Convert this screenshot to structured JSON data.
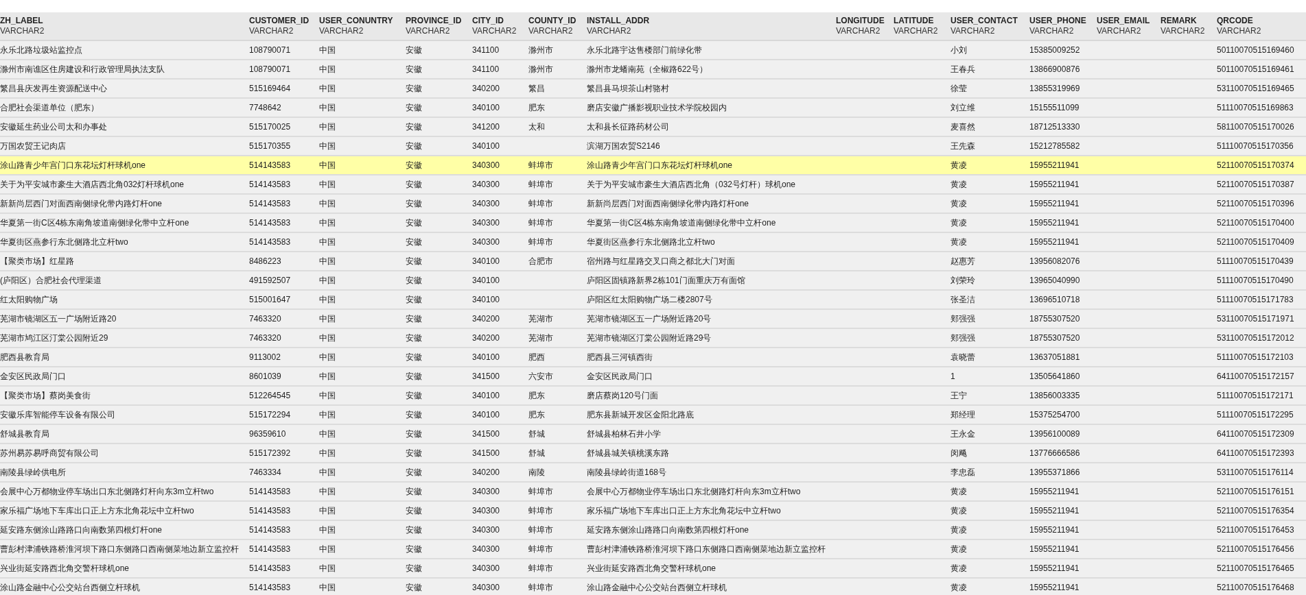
{
  "table": {
    "columns": [
      {
        "name": "ZH_LABEL",
        "type": "VARCHAR2"
      },
      {
        "name": "CUSTOMER_ID",
        "type": "VARCHAR2"
      },
      {
        "name": "USER_CONUNTRY",
        "type": "VARCHAR2"
      },
      {
        "name": "PROVINCE_ID",
        "type": "VARCHAR2"
      },
      {
        "name": "CITY_ID",
        "type": "VARCHAR2"
      },
      {
        "name": "COUNTY_ID",
        "type": "VARCHAR2"
      },
      {
        "name": "INSTALL_ADDR",
        "type": "VARCHAR2"
      },
      {
        "name": "LONGITUDE",
        "type": "VARCHAR2"
      },
      {
        "name": "LATITUDE",
        "type": "VARCHAR2"
      },
      {
        "name": "USER_CONTACT",
        "type": "VARCHAR2"
      },
      {
        "name": "USER_PHONE",
        "type": "VARCHAR2"
      },
      {
        "name": "USER_EMAIL",
        "type": "VARCHAR2"
      },
      {
        "name": "REMARK",
        "type": "VARCHAR2"
      },
      {
        "name": "QRCODE",
        "type": "VARCHAR2"
      }
    ],
    "rows": [
      {
        "selected": false,
        "zh_label": "永乐北路垃圾站监控点",
        "customer_id": "108790071",
        "country": "中国",
        "province": "安徽",
        "city_id": "341100",
        "county": "滁州市",
        "install_addr": "永乐北路宇达售楼部门前绿化带",
        "contact": "小刘",
        "phone": "15385009252",
        "qrcode": "50110070515169460"
      },
      {
        "selected": false,
        "zh_label": "滁州市南谯区住房建设和行政管理局执法支队",
        "customer_id": "108790071",
        "country": "中国",
        "province": "安徽",
        "city_id": "341100",
        "county": "滁州市",
        "install_addr": "滁州市龙蟠南苑（全椒路622号）",
        "contact": "王春兵",
        "phone": "13866900876",
        "qrcode": "50110070515169461"
      },
      {
        "selected": false,
        "zh_label": "繁昌县庆发再生资源配送中心",
        "customer_id": "515169464",
        "country": "中国",
        "province": "安徽",
        "city_id": "340200",
        "county": "繁昌",
        "install_addr": "繁昌县马坝茶山村骆村",
        "contact": "徐莹",
        "phone": "13855319969",
        "qrcode": "53110070515169465"
      },
      {
        "selected": false,
        "zh_label": "合肥社会渠道单位（肥东）",
        "customer_id": "7748642",
        "country": "中国",
        "province": "安徽",
        "city_id": "340100",
        "county": "肥东",
        "install_addr": "磨店安徽广播影视职业技术学院校园内",
        "contact": "刘立维",
        "phone": "15155511099",
        "qrcode": "51110070515169863"
      },
      {
        "selected": false,
        "zh_label": "安徽延生药业公司太和办事处",
        "customer_id": "515170025",
        "country": "中国",
        "province": "安徽",
        "city_id": "341200",
        "county": "太和",
        "install_addr": "太和县长征路药材公司",
        "contact": "麦喜然",
        "phone": "18712513330",
        "qrcode": "58110070515170026"
      },
      {
        "selected": false,
        "zh_label": "万国农贸王记肉店",
        "customer_id": "515170355",
        "country": "中国",
        "province": "安徽",
        "city_id": "340100",
        "install_addr": "滨湖万国农贸S2146",
        "contact": "王先森",
        "phone": "15212785582",
        "qrcode": "51110070515170356"
      },
      {
        "selected": true,
        "zh_label": "涂山路青少年宫门口东花坛灯杆球机one",
        "customer_id": "514143583",
        "country": "中国",
        "province": "安徽",
        "city_id": "340300",
        "county": "蚌埠市",
        "install_addr": "涂山路青少年宫门口东花坛灯杆球机one",
        "contact": "黄凌",
        "phone": "15955211941",
        "qrcode": "52110070515170374"
      },
      {
        "selected": false,
        "zh_label": "关于为平安城市豪生大酒店西北角032灯杆球机one",
        "customer_id": "514143583",
        "country": "中国",
        "province": "安徽",
        "city_id": "340300",
        "county": "蚌埠市",
        "install_addr": "关于为平安城市豪生大酒店西北角（032号灯杆）球机one",
        "contact": "黄凌",
        "phone": "15955211941",
        "qrcode": "52110070515170387"
      },
      {
        "selected": false,
        "zh_label": "新新尚层西门对面西南侧绿化带内路灯杆one",
        "customer_id": "514143583",
        "country": "中国",
        "province": "安徽",
        "city_id": "340300",
        "county": "蚌埠市",
        "install_addr": "新新尚层西门对面西南侧绿化带内路灯杆one",
        "contact": "黄凌",
        "phone": "15955211941",
        "qrcode": "52110070515170396"
      },
      {
        "selected": false,
        "zh_label": "华夏第一街C区4栋东南角坡道南侧绿化带中立杆one",
        "customer_id": "514143583",
        "country": "中国",
        "province": "安徽",
        "city_id": "340300",
        "county": "蚌埠市",
        "install_addr": "华夏第一街C区4栋东南角坡道南侧绿化带中立杆one",
        "contact": "黄凌",
        "phone": "15955211941",
        "qrcode": "52110070515170400"
      },
      {
        "selected": false,
        "zh_label": "华夏街区燕参行东北侧路北立杆two",
        "customer_id": "514143583",
        "country": "中国",
        "province": "安徽",
        "city_id": "340300",
        "county": "蚌埠市",
        "install_addr": "华夏街区燕参行东北侧路北立杆two",
        "contact": "黄凌",
        "phone": "15955211941",
        "qrcode": "52110070515170409"
      },
      {
        "selected": false,
        "zh_label": "【聚类市场】红星路",
        "customer_id": "8486223",
        "country": "中国",
        "province": "安徽",
        "city_id": "340100",
        "county": "合肥市",
        "install_addr": "宿州路与红星路交叉口商之都北大门对面",
        "contact": "赵惠芳",
        "phone": "13956082076",
        "qrcode": "51110070515170439"
      },
      {
        "selected": false,
        "zh_label": "(庐阳区）合肥社会代理渠道",
        "customer_id": "491592507",
        "country": "中国",
        "province": "安徽",
        "city_id": "340100",
        "install_addr": "庐阳区固镇路新界2栋101门面重庆万有面馆",
        "contact": "刘荣玲",
        "phone": "13965040990",
        "qrcode": "51110070515170490"
      },
      {
        "selected": false,
        "zh_label": "红太阳购物广场",
        "customer_id": "515001647",
        "country": "中国",
        "province": "安徽",
        "city_id": "340100",
        "install_addr": "庐阳区红太阳购物广场二楼2807号",
        "contact": "张圣洁",
        "phone": "13696510718",
        "qrcode": "51110070515171783"
      },
      {
        "selected": false,
        "zh_label": "芜湖市镜湖区五一广场附近路20",
        "customer_id": "7463320",
        "country": "中国",
        "province": "安徽",
        "city_id": "340200",
        "county": "芜湖市",
        "install_addr": "芜湖市镜湖区五一广场附近路20号",
        "contact": "郏强强",
        "phone": "18755307520",
        "qrcode": "53110070515171971"
      },
      {
        "selected": false,
        "zh_label": "芜湖市鸠江区汀棠公园附近29",
        "customer_id": "7463320",
        "country": "中国",
        "province": "安徽",
        "city_id": "340200",
        "county": "芜湖市",
        "install_addr": "芜湖市镜湖区汀棠公园附近路29号",
        "contact": "郏强强",
        "phone": "18755307520",
        "qrcode": "53110070515172012"
      },
      {
        "selected": false,
        "zh_label": "肥西县教育局",
        "customer_id": "9113002",
        "country": "中国",
        "province": "安徽",
        "city_id": "340100",
        "county": "肥西",
        "install_addr": "肥西县三河镇西街",
        "contact": "袁晓蕾",
        "phone": "13637051881",
        "qrcode": "51110070515172103"
      },
      {
        "selected": false,
        "zh_label": "金安区民政局门口",
        "customer_id": "8601039",
        "country": "中国",
        "province": "安徽",
        "city_id": "341500",
        "county": "六安市",
        "install_addr": "金安区民政局门口",
        "contact": "1",
        "phone": "13505641860",
        "qrcode": "64110070515172157"
      },
      {
        "selected": false,
        "zh_label": "【聚类市场】蔡岗美食街",
        "customer_id": "512264545",
        "country": "中国",
        "province": "安徽",
        "city_id": "340100",
        "county": "肥东",
        "install_addr": "磨店蔡岗120号门面",
        "contact": "王宁",
        "phone": "13856003335",
        "qrcode": "51110070515172171"
      },
      {
        "selected": false,
        "zh_label": "安徽乐库智能停车设备有限公司",
        "customer_id": "515172294",
        "country": "中国",
        "province": "安徽",
        "city_id": "340100",
        "county": "肥东",
        "install_addr": "肥东县新城开发区金阳北路底",
        "contact": "郑经理",
        "phone": "15375254700",
        "qrcode": "51110070515172295"
      },
      {
        "selected": false,
        "zh_label": "舒城县教育局",
        "customer_id": "96359610",
        "country": "中国",
        "province": "安徽",
        "city_id": "341500",
        "county": "舒城",
        "install_addr": "舒城县柏林石井小学",
        "contact": "王永金",
        "phone": "13956100089",
        "qrcode": "64110070515172309"
      },
      {
        "selected": false,
        "zh_label": "苏州易苏易呼商贸有限公司",
        "customer_id": "515172392",
        "country": "中国",
        "province": "安徽",
        "city_id": "341500",
        "county": "舒城",
        "install_addr": "舒城县城关镇桃溪东路",
        "contact": "闵飚",
        "phone": "13776666586",
        "qrcode": "64110070515172393"
      },
      {
        "selected": false,
        "zh_label": "南陵县绿岭供电所",
        "customer_id": "7463334",
        "country": "中国",
        "province": "安徽",
        "city_id": "340200",
        "county": "南陵",
        "install_addr": "南陵县绿岭街道168号",
        "contact": "李忠磊",
        "phone": "13955371866",
        "qrcode": "53110070515176114"
      },
      {
        "selected": false,
        "zh_label": "会展中心万都物业停车场出口东北侧路灯杆向东3m立杆two",
        "customer_id": "514143583",
        "country": "中国",
        "province": "安徽",
        "city_id": "340300",
        "county": "蚌埠市",
        "install_addr": "会展中心万都物业停车场出口东北侧路灯杆向东3m立杆two",
        "contact": "黄凌",
        "phone": "15955211941",
        "qrcode": "52110070515176151"
      },
      {
        "selected": false,
        "zh_label": "家乐福广场地下车库出口正上方东北角花坛中立杆two",
        "customer_id": "514143583",
        "country": "中国",
        "province": "安徽",
        "city_id": "340300",
        "county": "蚌埠市",
        "install_addr": "家乐福广场地下车库出口正上方东北角花坛中立杆two",
        "contact": "黄凌",
        "phone": "15955211941",
        "qrcode": "52110070515176354"
      },
      {
        "selected": false,
        "zh_label": "延安路东侧涂山路路口向南数第四根灯杆one",
        "customer_id": "514143583",
        "country": "中国",
        "province": "安徽",
        "city_id": "340300",
        "county": "蚌埠市",
        "install_addr": "延安路东侧涂山路路口向南数第四根灯杆one",
        "contact": "黄凌",
        "phone": "15955211941",
        "qrcode": "52110070515176453"
      },
      {
        "selected": false,
        "zh_label": "曹彭村津浦铁路桥淮河坝下路口东侧路口西南侧菜地边新立监控杆",
        "customer_id": "514143583",
        "country": "中国",
        "province": "安徽",
        "city_id": "340300",
        "county": "蚌埠市",
        "install_addr": "曹彭村津浦铁路桥淮河坝下路口东侧路口西南侧菜地边新立监控杆",
        "contact": "黄凌",
        "phone": "15955211941",
        "qrcode": "52110070515176456"
      },
      {
        "selected": false,
        "zh_label": "兴业街延安路西北角交警杆球机one",
        "customer_id": "514143583",
        "country": "中国",
        "province": "安徽",
        "city_id": "340300",
        "county": "蚌埠市",
        "install_addr": "兴业街延安路西北角交警杆球机one",
        "contact": "黄凌",
        "phone": "15955211941",
        "qrcode": "52110070515176465"
      },
      {
        "selected": false,
        "zh_label": "涂山路金融中心公交站台西侧立杆球机",
        "customer_id": "514143583",
        "country": "中国",
        "province": "安徽",
        "city_id": "340300",
        "county": "蚌埠市",
        "install_addr": "涂山路金融中心公交站台西侧立杆球机",
        "contact": "黄凌",
        "phone": "15955211941",
        "qrcode": "52110070515176468"
      }
    ]
  }
}
